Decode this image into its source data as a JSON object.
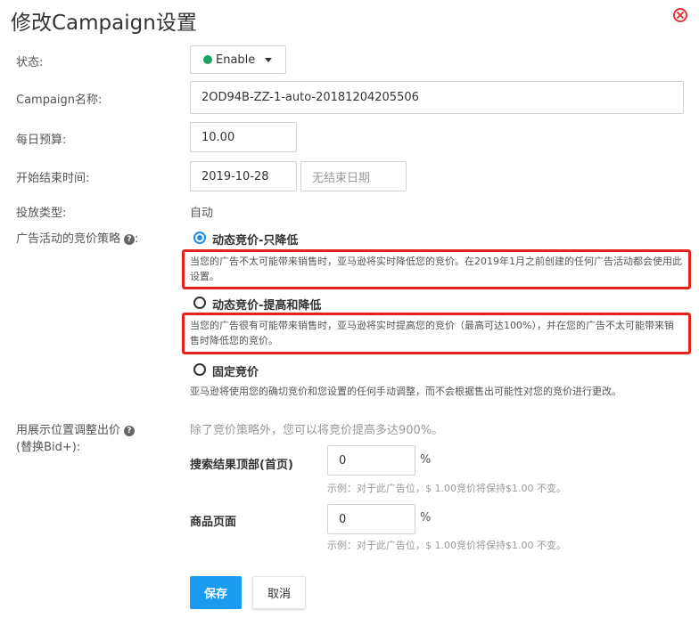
{
  "dialog": {
    "title": "修改Campaign设置"
  },
  "status": {
    "label": "状态:",
    "value": "Enable",
    "color": "#1aa260"
  },
  "campaign_name": {
    "label": "Campaign名称:",
    "value": "2OD94B-ZZ-1-auto-20181204205506"
  },
  "daily_budget": {
    "label": "每日预算:",
    "value": "10.00"
  },
  "dates": {
    "label": "开始结束时间:",
    "start": "2019-10-28",
    "end_placeholder": "无结束日期"
  },
  "targeting": {
    "label": "投放类型:",
    "value": "自动"
  },
  "bidding": {
    "label": "广告活动的竞价策略",
    "options": [
      {
        "label": "动态竞价-只降低",
        "checked": true,
        "desc": "当您的广告不太可能带来销售时，亚马逊将实时降低您的竞价。在2019年1月之前创建的任何广告活动都会使用此设置。"
      },
      {
        "label": "动态竞价-提高和降低",
        "checked": false,
        "desc": "当您的广告很有可能带来销售时，亚马逊将实时提高您的竞价（最高可达100%），并在您的广告不太可能带来销售时降低您的竞价。"
      },
      {
        "label": "固定竞价",
        "checked": false,
        "desc": "亚马逊将使用您的确切竞价和您设置的任何手动调整，而不会根据售出可能性对您的竞价进行更改。"
      }
    ]
  },
  "placement": {
    "label_line1": "用展示位置调整出价",
    "label_line2": "(替换Bid+):",
    "hint": "除了竞价策略外，您可以将竞价提高多达900%。",
    "top_search": {
      "label": "搜索结果顶部(首页)",
      "value": "0",
      "unit": "%",
      "example": "示例：对于此广告位，$ 1.00竞价将保持$1.00 不变。"
    },
    "product_page": {
      "label": "商品页面",
      "value": "0",
      "unit": "%",
      "example": "示例：对于此广告位，$ 1.00竞价将保持$1.00 不变。"
    }
  },
  "buttons": {
    "save": "保存",
    "cancel": "取消",
    "accent": "#1a9bf0"
  },
  "highlight_color": "#e5231b"
}
